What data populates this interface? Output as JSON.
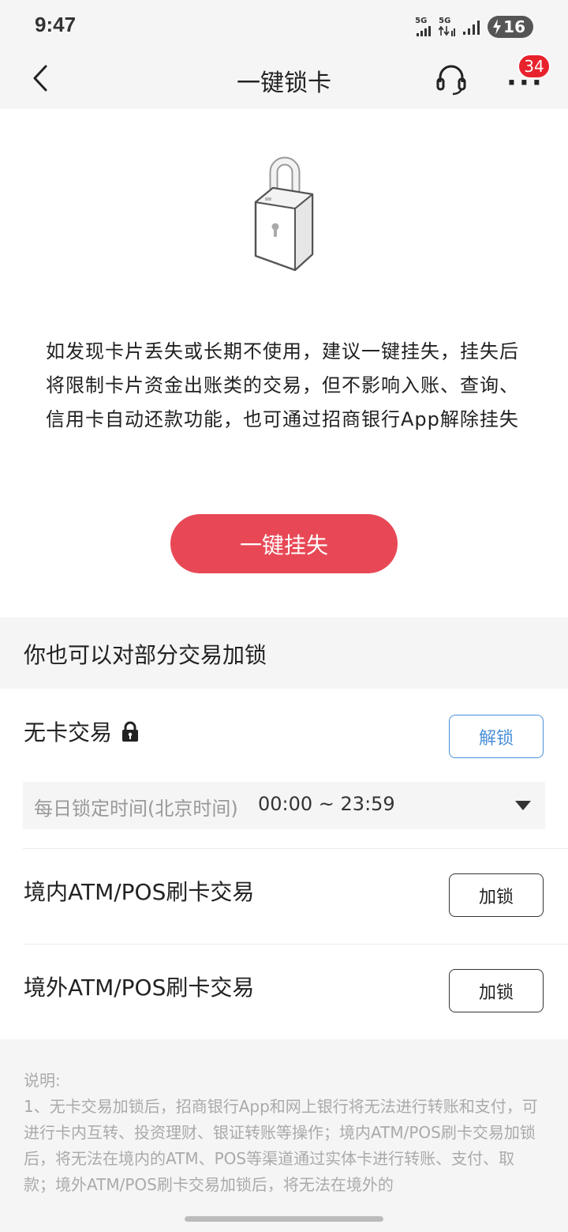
{
  "status_bar": {
    "time": "9:47",
    "signal1_label": "5G",
    "signal2_label": "5G",
    "battery_level": "16"
  },
  "nav": {
    "title": "一键锁卡",
    "more_dots": "···",
    "badge_count": "34"
  },
  "hero": {
    "description": "如发现卡片丢失或长期不使用，建议一键挂失，挂失后将限制卡片资金出账类的交易，但不影响入账、查询、信用卡自动还款功能，也可通过招商银行App解除挂失",
    "primary_button": "一键挂失"
  },
  "section": {
    "title": "你也可以对部分交易加锁"
  },
  "rows": [
    {
      "label": "无卡交易",
      "button": "解锁",
      "locked": true
    },
    {
      "label": "境内ATM/POS刷卡交易",
      "button": "加锁",
      "locked": false
    },
    {
      "label": "境外ATM/POS刷卡交易",
      "button": "加锁",
      "locked": false
    }
  ],
  "time_select": {
    "label": "每日锁定时间(北京时间)",
    "value": "00:00 ~ 23:59"
  },
  "notes": {
    "heading": "说明:",
    "text": "1、无卡交易加锁后，招商银行App和网上银行将无法进行转账和支付，可进行卡内互转、投资理财、银证转账等操作；境内ATM/POS刷卡交易加锁后，将无法在境内的ATM、POS等渠道通过实体卡进行转账、支付、取款；境外ATM/POS刷卡交易加锁后，将无法在境外的"
  },
  "colors": {
    "primary": "#e84855",
    "badge": "#e8222c",
    "link_blue": "#4a8fd8",
    "background": "#f5f5f5"
  }
}
